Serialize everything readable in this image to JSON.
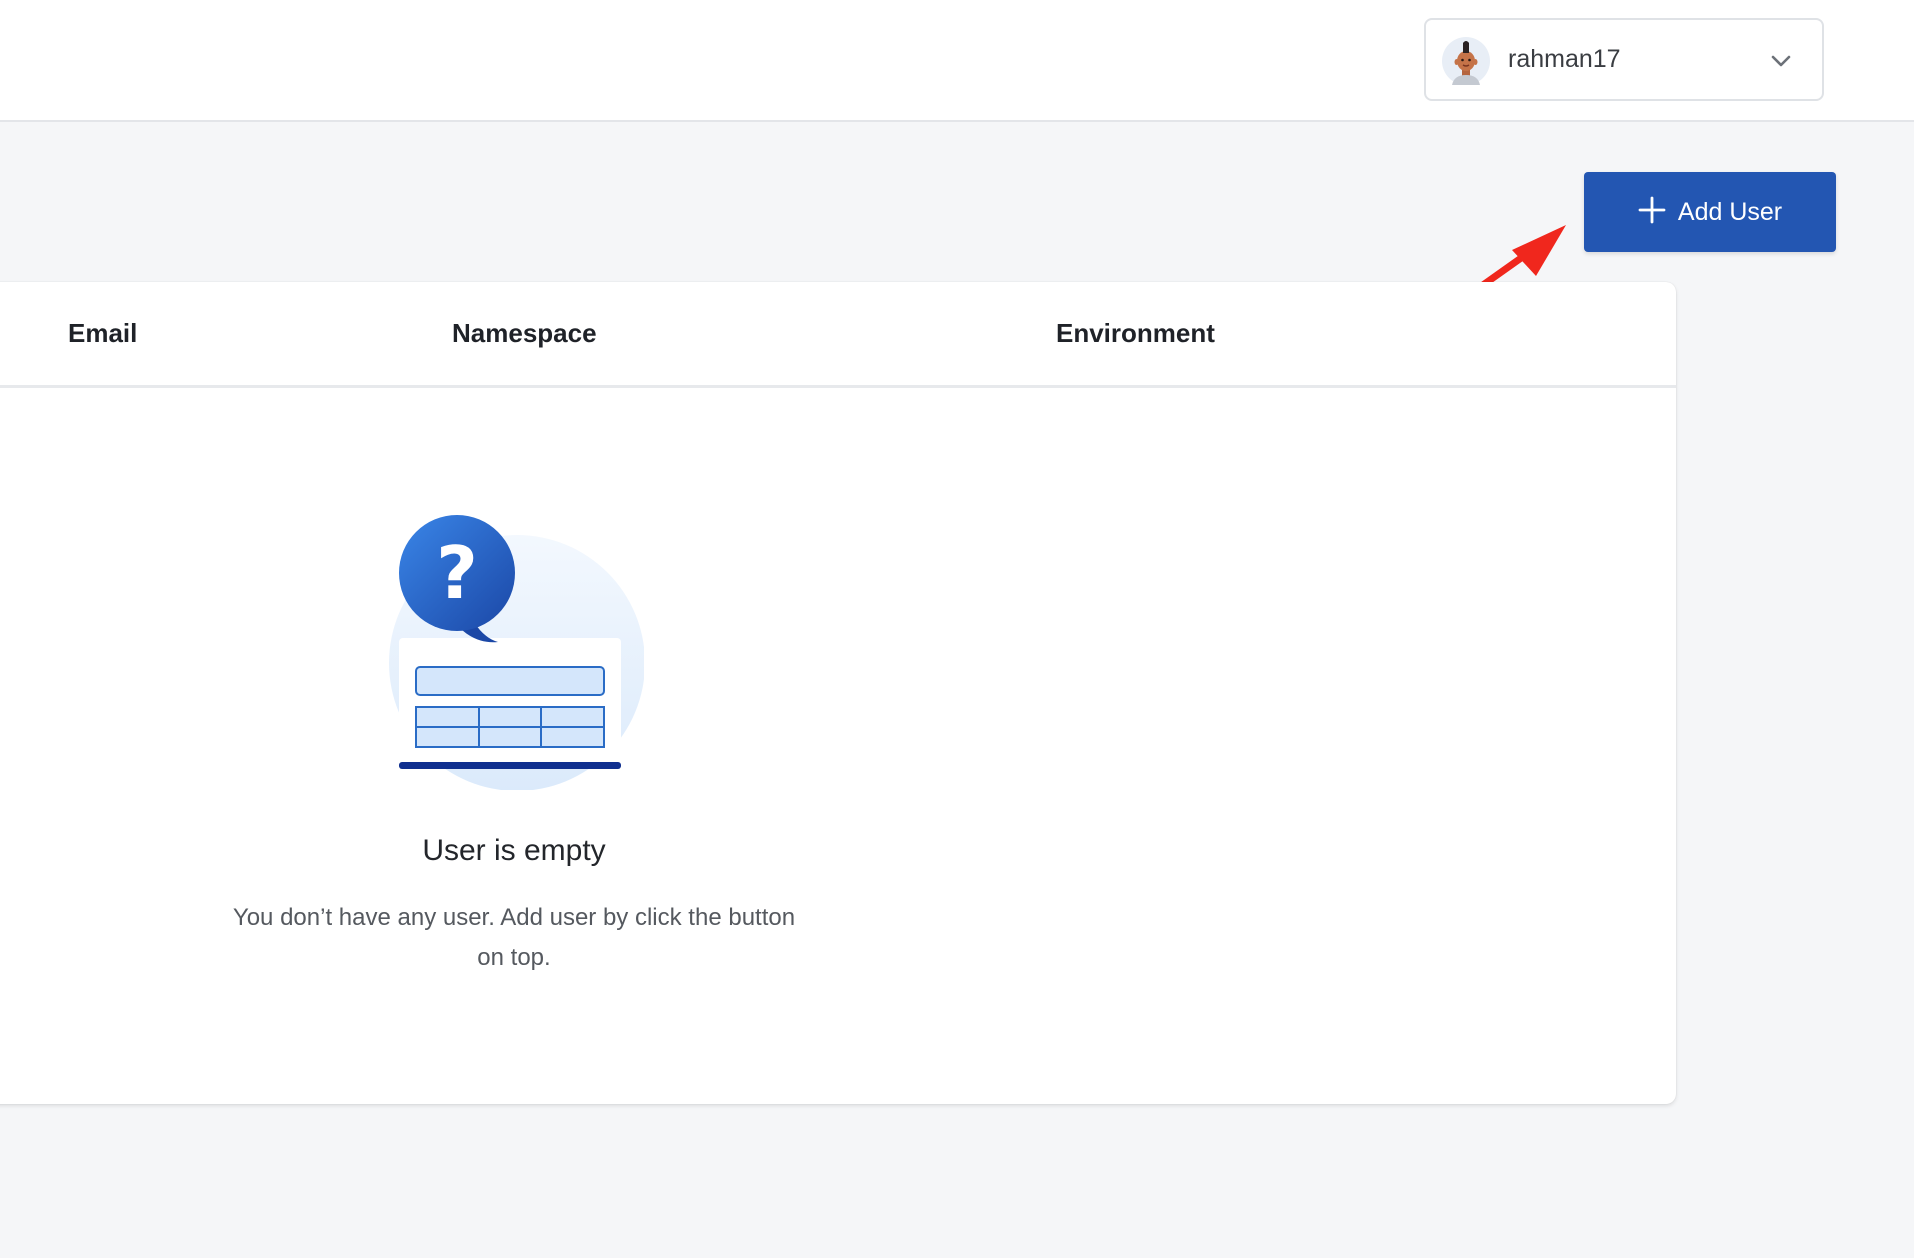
{
  "header": {
    "username": "rahman17"
  },
  "toolbar": {
    "add_user_label": "Add User"
  },
  "table": {
    "columns": [
      "Email",
      "Namespace",
      "Environment"
    ]
  },
  "empty_state": {
    "title": "User is empty",
    "description_line1": "You don’t have any user. Add user by click the button",
    "description_line2": "on top."
  },
  "colors": {
    "primary": "#2356b2",
    "annotation_arrow": "#f0271d",
    "background": "#f5f6f8"
  },
  "icons": {
    "avatar": "avatar-icon",
    "dropdown": "chevron-down-icon",
    "add": "plus-icon",
    "empty": "question-bubble-table-illustration"
  }
}
